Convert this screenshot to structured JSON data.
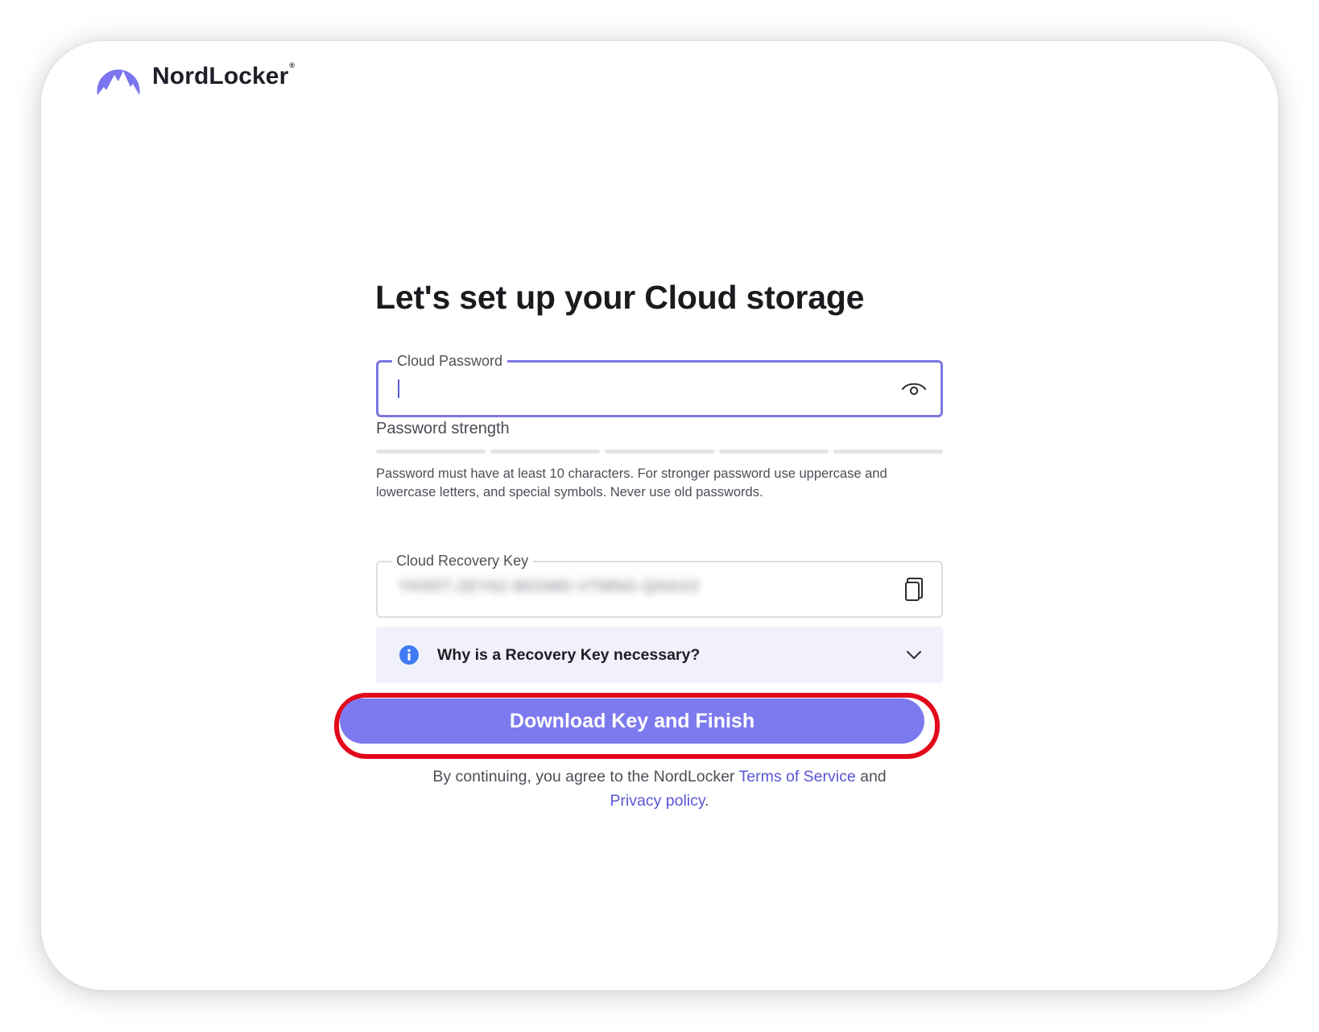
{
  "brand": {
    "name": "NordLocker",
    "reg_mark": "®",
    "logo_color": "#7b74ee"
  },
  "heading": "Let's set up your Cloud storage",
  "password_field": {
    "label": "Cloud Password",
    "value": "",
    "toggle_icon": "eye-icon"
  },
  "strength": {
    "label": "Password strength",
    "segments": 5,
    "level": 0
  },
  "hint": "Password must have at least 10 characters. For stronger password use uppercase and lowercase letters, and special symbols. Never use old passwords.",
  "recovery_key": {
    "label": "Cloud Recovery Key",
    "value_blurred": "YKN5T-ZEY62-8KGMD-VTMNG-QHAX3",
    "copy_icon": "copy-icon"
  },
  "info": {
    "icon": "info-icon",
    "text": "Why is a Recovery Key necessary?",
    "expand_icon": "chevron-down-icon"
  },
  "cta": {
    "label": "Download Key and Finish",
    "color": "#7d7aef",
    "highlight_color": "#e3091b"
  },
  "legal": {
    "prefix": "By continuing, you agree to the NordLocker ",
    "tos_link": "Terms of Service",
    "middle": " and ",
    "privacy_link": "Privacy policy",
    "suffix": "."
  }
}
